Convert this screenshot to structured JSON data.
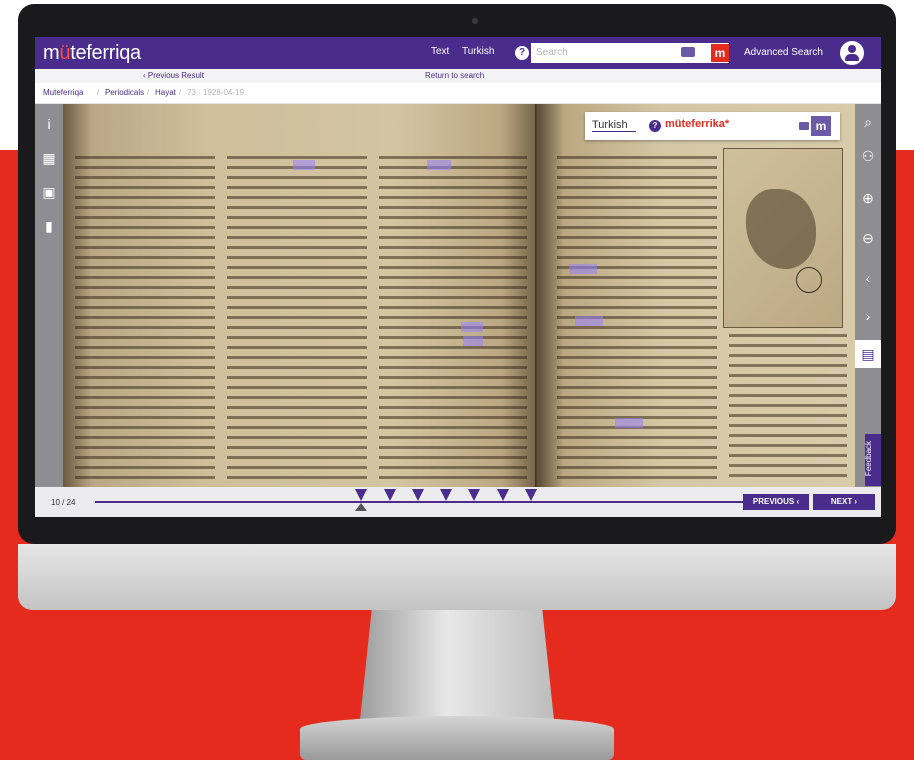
{
  "header": {
    "logo": "müteferriqa",
    "logo_first": "m",
    "logo_dot": "ü",
    "logo_rest": "teferriqa",
    "search_type": "Text",
    "search_lang": "Turkish",
    "search_placeholder": "Search",
    "help": "?",
    "m_icon": "m",
    "advanced_search": "Advanced Search"
  },
  "nav": {
    "previous_result": "‹ Previous Result",
    "return_to_search": "Return to search"
  },
  "breadcrumb": {
    "items": [
      "Muteferriqa",
      "Periodicals",
      "Hayat",
      "73 · 1928-04-19"
    ],
    "sep": "/"
  },
  "search_panel": {
    "language": "Turkish",
    "term": "müteferrika*",
    "help": "?",
    "m_icon": "m"
  },
  "left_tools": [
    {
      "name": "info-icon",
      "glyph": "i"
    },
    {
      "name": "thumbnails-icon",
      "glyph": "▦"
    },
    {
      "name": "image-icon",
      "glyph": "▣"
    },
    {
      "name": "bookmark-icon",
      "glyph": "▮"
    }
  ],
  "right_tools": [
    {
      "name": "search-icon",
      "glyph": "⌕"
    },
    {
      "name": "share-icon",
      "glyph": "⚇"
    },
    {
      "name": "zoom-in-icon",
      "glyph": "⊕"
    },
    {
      "name": "zoom-out-icon",
      "glyph": "⊖"
    },
    {
      "name": "prev-page-icon",
      "glyph": "‹"
    },
    {
      "name": "next-page-icon",
      "glyph": "›"
    },
    {
      "name": "text-view-icon",
      "glyph": "▤"
    }
  ],
  "feedback": "Feedback",
  "pager": {
    "page_count": "10 / 24",
    "current_page": 10,
    "total_pages": 24,
    "previous": "PREVIOUS ‹",
    "next": "NEXT ›",
    "result_markers": [
      10,
      11,
      12,
      13,
      14,
      15,
      16
    ]
  },
  "colors": {
    "brand": "#4a2c8c",
    "accent": "#e42b1e",
    "highlight": "#9682ff"
  }
}
